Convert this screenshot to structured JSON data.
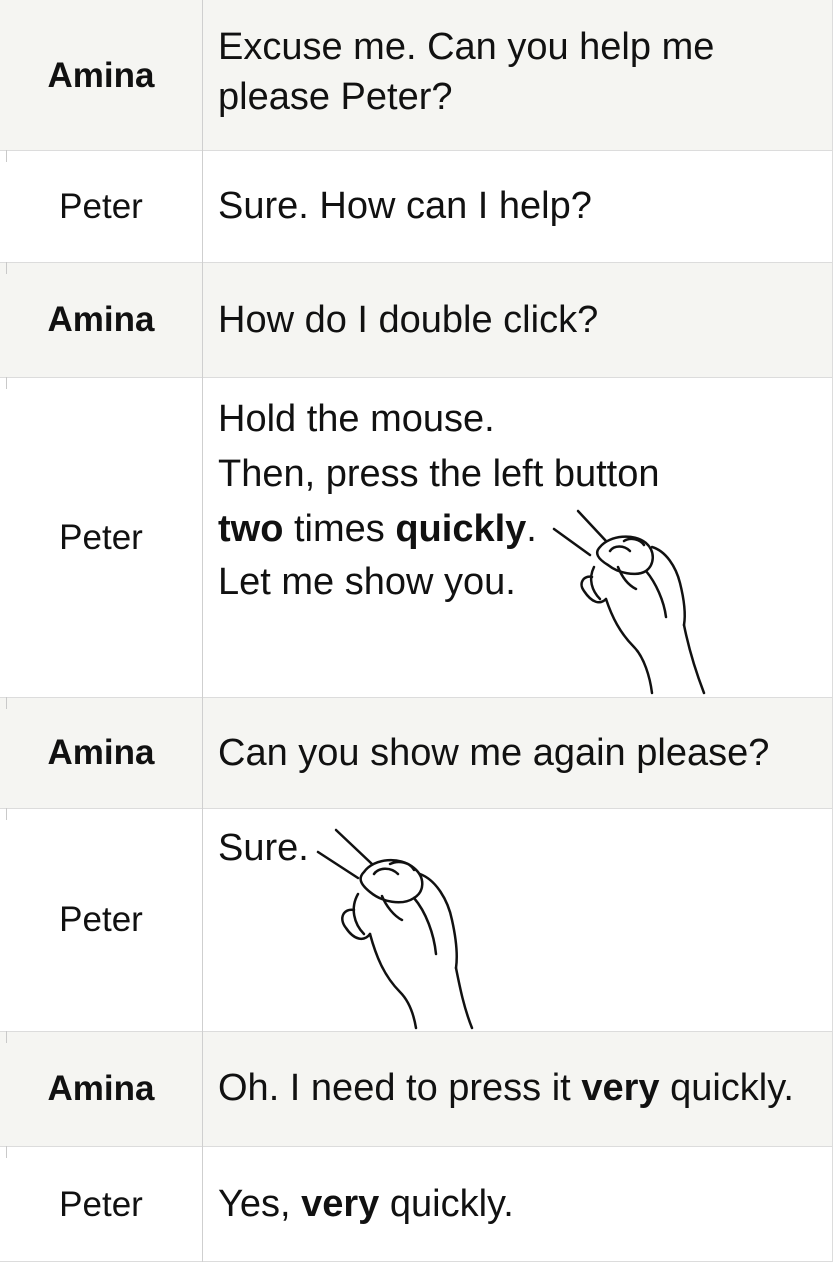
{
  "dialogue": [
    {
      "speaker": "Amina",
      "text_parts": [
        "Excuse me. Can you help me",
        "please Peter?"
      ]
    },
    {
      "speaker": "Peter",
      "text_parts": [
        "Sure. How can I help?"
      ]
    },
    {
      "speaker": "Amina",
      "text_parts": [
        "How do I double click?"
      ]
    },
    {
      "speaker": "Peter",
      "line1": "Hold the mouse.",
      "line2": "Then, press the left button",
      "line3_bold_a": "two",
      "line3_mid": " times ",
      "line3_bold_b": "quickly",
      "line3_end": ".",
      "line4": "Let me show you."
    },
    {
      "speaker": "Amina",
      "text_parts": [
        "Can you show me again please?"
      ]
    },
    {
      "speaker": "Peter",
      "text_parts": [
        "Sure."
      ]
    },
    {
      "speaker": "Amina",
      "pre": "Oh. I need to press it ",
      "bold": "very",
      "post": " quickly."
    },
    {
      "speaker": "Peter",
      "pre": "Yes, ",
      "bold": "very",
      "post": " quickly."
    }
  ],
  "images": {
    "hand_icon": "hand-on-mouse-icon"
  }
}
